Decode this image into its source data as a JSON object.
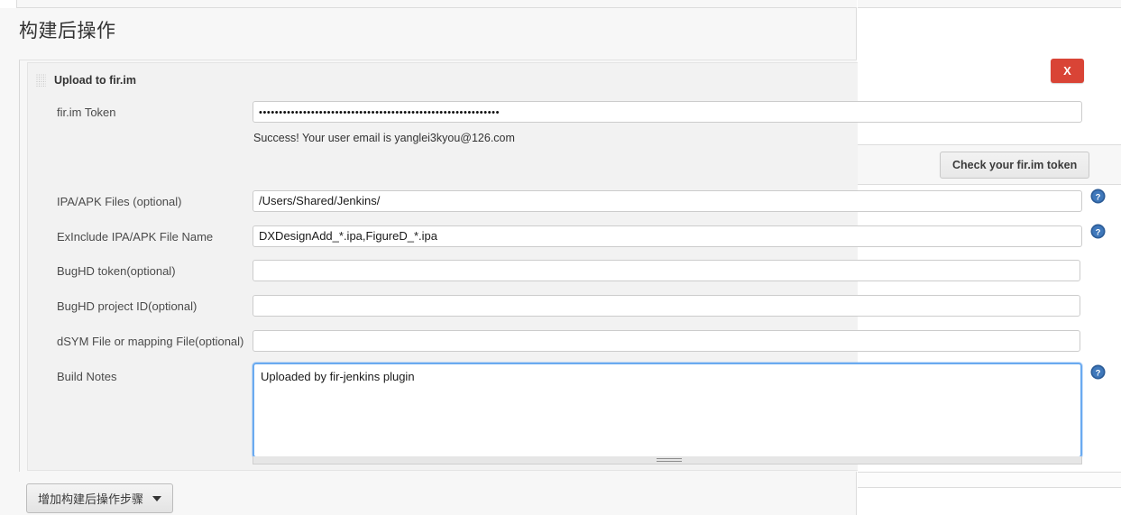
{
  "page": {
    "section_title": "构建后操作"
  },
  "step": {
    "title": "Upload to fir.im",
    "drag_handle_icon": "drag-grip-icon",
    "delete_button_label": "X"
  },
  "form": {
    "rows": [
      {
        "label": "fir.im Token",
        "value": "••••••••••••••••••••••••••••••••••••••••••••••••••••••••••••",
        "type": "password",
        "help": false
      },
      {
        "label": "IPA/APK Files (optional)",
        "value": "/Users/Shared/Jenkins/",
        "type": "text",
        "help": true
      },
      {
        "label": "ExInclude IPA/APK File Name",
        "value": "DXDesignAdd_*.ipa,FigureD_*.ipa",
        "type": "text",
        "help": true
      },
      {
        "label": "BugHD token(optional)",
        "value": "",
        "type": "text",
        "help": false
      },
      {
        "label": "BugHD project ID(optional)",
        "value": "",
        "type": "text",
        "help": false
      },
      {
        "label": "dSYM File or mapping File(optional)",
        "value": "",
        "type": "text",
        "help": false
      },
      {
        "label": "Build Notes",
        "value": "Uploaded by fir-jenkins plugin",
        "type": "textarea",
        "help": true
      }
    ],
    "token_status_message": "Success! Your user email is yanglei3kyou@126.com",
    "check_token_button": "Check your fir.im token"
  },
  "footer": {
    "add_step_button": "增加构建后操作步骤",
    "caret_icon": "chevron-down-icon"
  },
  "icons": {
    "help": "help-circle-icon"
  },
  "colors": {
    "delete_red": "#d94436",
    "focus_blue": "#6aaaf0",
    "page_bg": "#f7f7f7",
    "panel_bg": "#f2f2f2"
  }
}
